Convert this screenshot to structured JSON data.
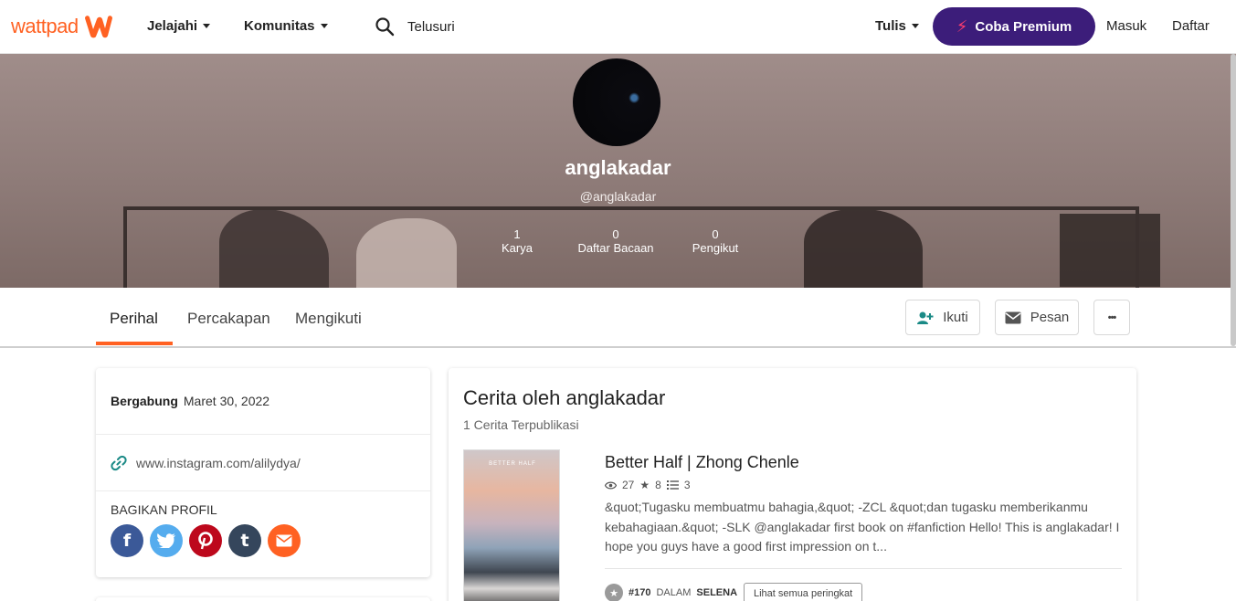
{
  "nav": {
    "logo_text": "wattpad",
    "explore": "Jelajahi",
    "community": "Komunitas",
    "search_placeholder": "Telusuri",
    "write": "Tulis",
    "premium": "Coba Premium",
    "login": "Masuk",
    "signup": "Daftar"
  },
  "profile": {
    "display_name": "anglakadar",
    "handle": "@anglakadar",
    "stats": [
      {
        "value": "1",
        "label": "Karya"
      },
      {
        "value": "0",
        "label": "Daftar Bacaan"
      },
      {
        "value": "0",
        "label": "Pengikut"
      }
    ]
  },
  "tabs": [
    "Perihal",
    "Percakapan",
    "Mengikuti"
  ],
  "actions": {
    "follow": "Ikuti",
    "message": "Pesan",
    "more": "•••"
  },
  "about": {
    "joined_label": "Bergabung",
    "joined_date": "Maret 30, 2022",
    "website": "www.instagram.com/alilydya/",
    "share_title": "BAGIKAN PROFIL"
  },
  "stories": {
    "title": "Cerita oleh anglakadar",
    "subtitle": "1 Cerita Terpublikasi",
    "items": [
      {
        "cover_text": "BETTER HALF",
        "title": "Better Half | Zhong Chenle",
        "reads": "27",
        "votes": "8",
        "parts": "3",
        "description": "&quot;Tugasku membuatmu bahagia,&quot; -ZCL &quot;dan tugasku memberikanmu kebahagiaan.&quot; -SLK @anglakadar first book on #fanfiction Hello! This is anglakadar! I hope you guys have a good first impression on t...",
        "rank_number": "#170",
        "rank_in": "DALAM",
        "rank_tag": "SELENA",
        "rank_button": "Lihat semua peringkat"
      }
    ]
  },
  "colors": {
    "brand": "#ff6122",
    "premium_bg": "#3c1d7a",
    "facebook": "#3b5998",
    "twitter": "#55acee",
    "pinterest": "#bd081c",
    "tumblr": "#35465c",
    "email": "#ff6122"
  }
}
